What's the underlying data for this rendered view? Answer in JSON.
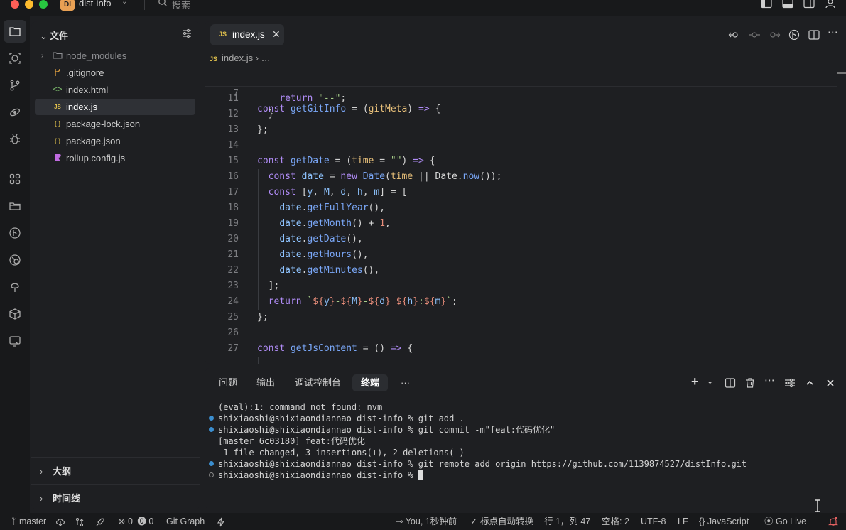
{
  "titlebar": {
    "project_badge": "DI",
    "project_name": "dist-info",
    "search_placeholder": "搜索"
  },
  "colors": {
    "badge": "#e8a054",
    "keyword": "#b08cf6",
    "function": "#7aa7f7",
    "string": "#a9d08b",
    "number": "#e88d7a",
    "terminal_dot": "#3b8ecf"
  },
  "activity_bar": {
    "icons": [
      "explorer-icon",
      "search-icon",
      "source-control-icon",
      "run-debug-icon",
      "bug-icon",
      "extensions-icon",
      "folder-icon",
      "git-graph-icon",
      "remote-icon",
      "tree-icon",
      "package-icon",
      "remote-explorer-icon"
    ]
  },
  "sidebar": {
    "title": "文件",
    "items": [
      {
        "label": "node_modules",
        "icon": "folder-icon"
      },
      {
        "label": ".gitignore",
        "icon": "git-icon"
      },
      {
        "label": "index.html",
        "icon": "html-icon"
      },
      {
        "label": "index.js",
        "icon": "js-icon",
        "icon_text": "JS"
      },
      {
        "label": "package-lock.json",
        "icon": "json-icon",
        "icon_text": "{ }"
      },
      {
        "label": "package.json",
        "icon": "json-icon",
        "icon_text": "{ }"
      },
      {
        "label": "rollup.config.js",
        "icon": "rollup-icon"
      }
    ],
    "outline_label": "大纲",
    "timeline_label": "时间线"
  },
  "editor": {
    "tab_icon": "JS",
    "tab_label": "index.js",
    "tab_close": "✕",
    "breadcrumb_icon": "JS",
    "breadcrumb_file": "index.js",
    "breadcrumb_rest": " › …",
    "sticky_line_number": "7",
    "line_numbers": [
      "11",
      "12",
      "13",
      "14",
      "15",
      "16",
      "17",
      "18",
      "19",
      "20",
      "21",
      "22",
      "23",
      "24",
      "25",
      "26",
      "27"
    ]
  },
  "panel": {
    "tabs": [
      "问题",
      "输出",
      "调试控制台",
      "终端"
    ],
    "more": "···",
    "terminal_lines": [
      {
        "text": "(eval):1: command not found: nvm",
        "marker": "none"
      },
      {
        "text": "shixiaoshi@shixiaondiannao dist-info % git add .",
        "marker": "blue"
      },
      {
        "text": "shixiaoshi@shixiaondiannao dist-info % git commit -m\"feat:代码优化\"",
        "marker": "blue"
      },
      {
        "text": "[master 6c03180] feat:代码优化",
        "marker": "none"
      },
      {
        "text": " 1 file changed, 3 insertions(+), 2 deletions(-)",
        "marker": "none"
      },
      {
        "text": "shixiaoshi@shixiaondiannao dist-info % git remote add origin https://github.com/1139874527/distInfo.git",
        "marker": "blue"
      },
      {
        "text": "shixiaoshi@shixiaondiannao dist-info % ",
        "marker": "empty"
      }
    ]
  },
  "statusbar": {
    "branch": "master",
    "errors": "0",
    "warnings": "0",
    "git_graph": "Git Graph",
    "blame": "You, 1秒钟前",
    "auto_convert": "标点自动转换",
    "position": "行 1，列 47",
    "spaces": "空格: 2",
    "encoding": "UTF-8",
    "eol": "LF",
    "language": "JavaScript",
    "golive": "Go Live"
  }
}
